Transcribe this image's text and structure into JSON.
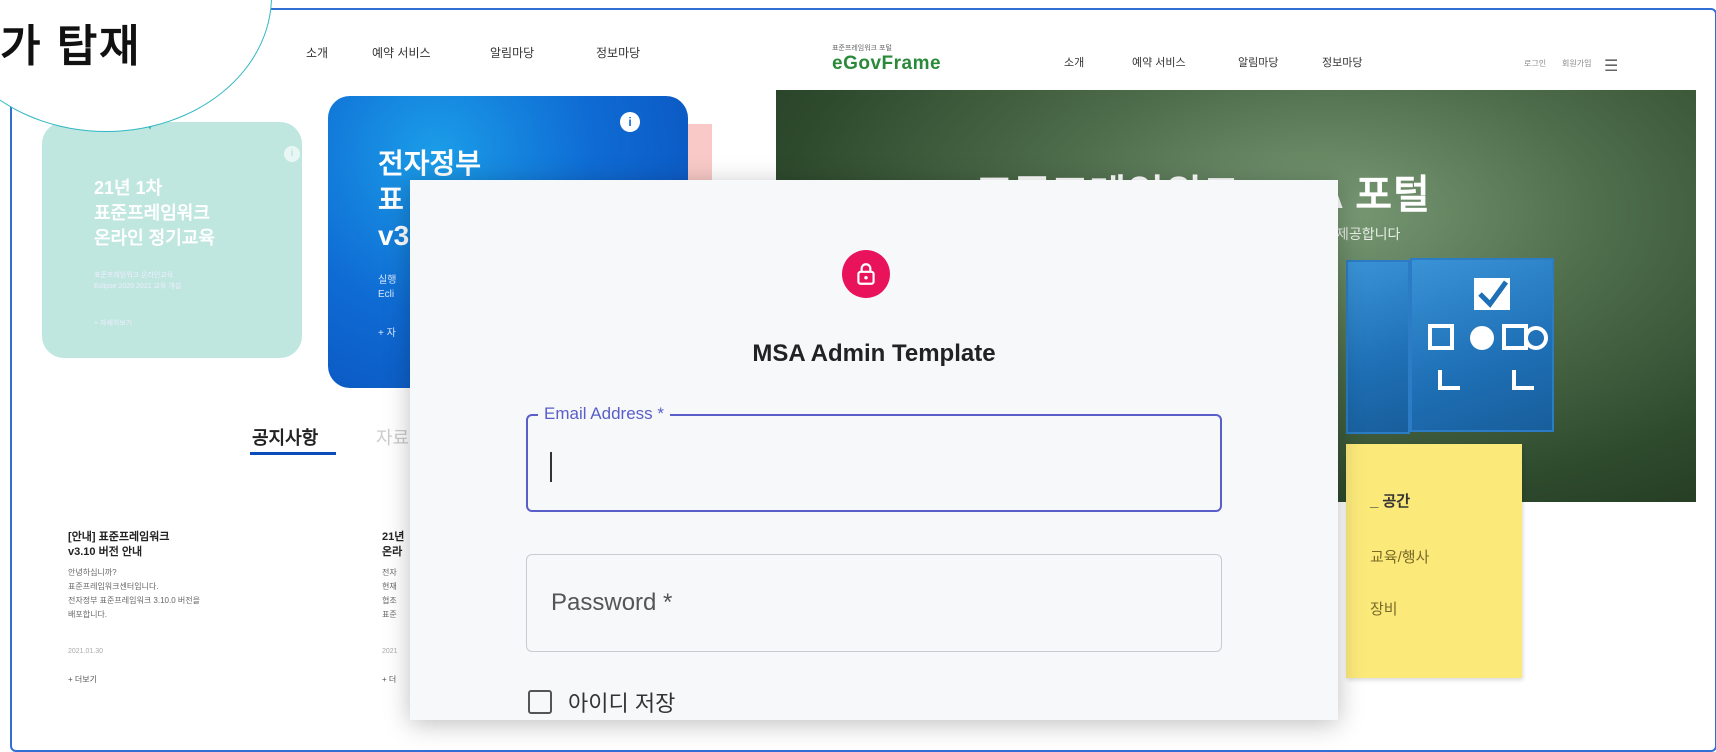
{
  "bubble": {
    "text": "가 탑재"
  },
  "left_site": {
    "nav": [
      "소개",
      "예약 서비스",
      "알림마당",
      "정보마당"
    ],
    "card_teal": {
      "title_lines": [
        "21년 1차",
        "표준프레임워크",
        "온라인 정기교육"
      ],
      "small_lines": [
        "표준프레임워크 온라인교육",
        "Eclipse 2020 2021 교육 개설"
      ],
      "more": "+ 자세히보기"
    },
    "card_blue": {
      "title_lines": [
        "전자정부",
        "표",
        "v3"
      ],
      "sub_lines": [
        "실행",
        "Ecli"
      ],
      "more": "+ 자"
    },
    "tabs": {
      "active": "공지사항",
      "inactive": "자료"
    },
    "notices": [
      {
        "title_lines": [
          "[안내] 표준프레임워크",
          "v3.10 버전 안내"
        ],
        "body_lines": [
          "안녕하십니까?",
          "표준프레임워크센터입니다.",
          "전자정부 표준프레임워크 3.10.0 버전을",
          "배포합니다."
        ],
        "date": "2021.01.30",
        "more": "+ 더보기"
      },
      {
        "title_lines": [
          "21년",
          "온라"
        ],
        "body_lines": [
          "전자",
          "현재",
          "협조",
          "표준"
        ],
        "date": "2021",
        "more": "+ 더"
      }
    ]
  },
  "right_site": {
    "brand_small": "표준프레임워크 포털",
    "brand": "eGovFrame",
    "nav": [
      "소개",
      "예약 서비스",
      "알림마당",
      "정보마당"
    ],
    "util": [
      "로그인",
      "회원가입"
    ],
    "hero_title": "표준프레임워크 MSA 포털",
    "hero_sub": "제공합니다",
    "yellow_links": [
      "_ 공간",
      "교육/행사",
      "장비"
    ]
  },
  "modal": {
    "title": "MSA Admin Template",
    "email_label": "Email Address *",
    "email_value": "",
    "password_placeholder": "Password *",
    "remember_label": "아이디 저장",
    "accent": "#5a5ec8",
    "lock_color": "#e8135a"
  }
}
